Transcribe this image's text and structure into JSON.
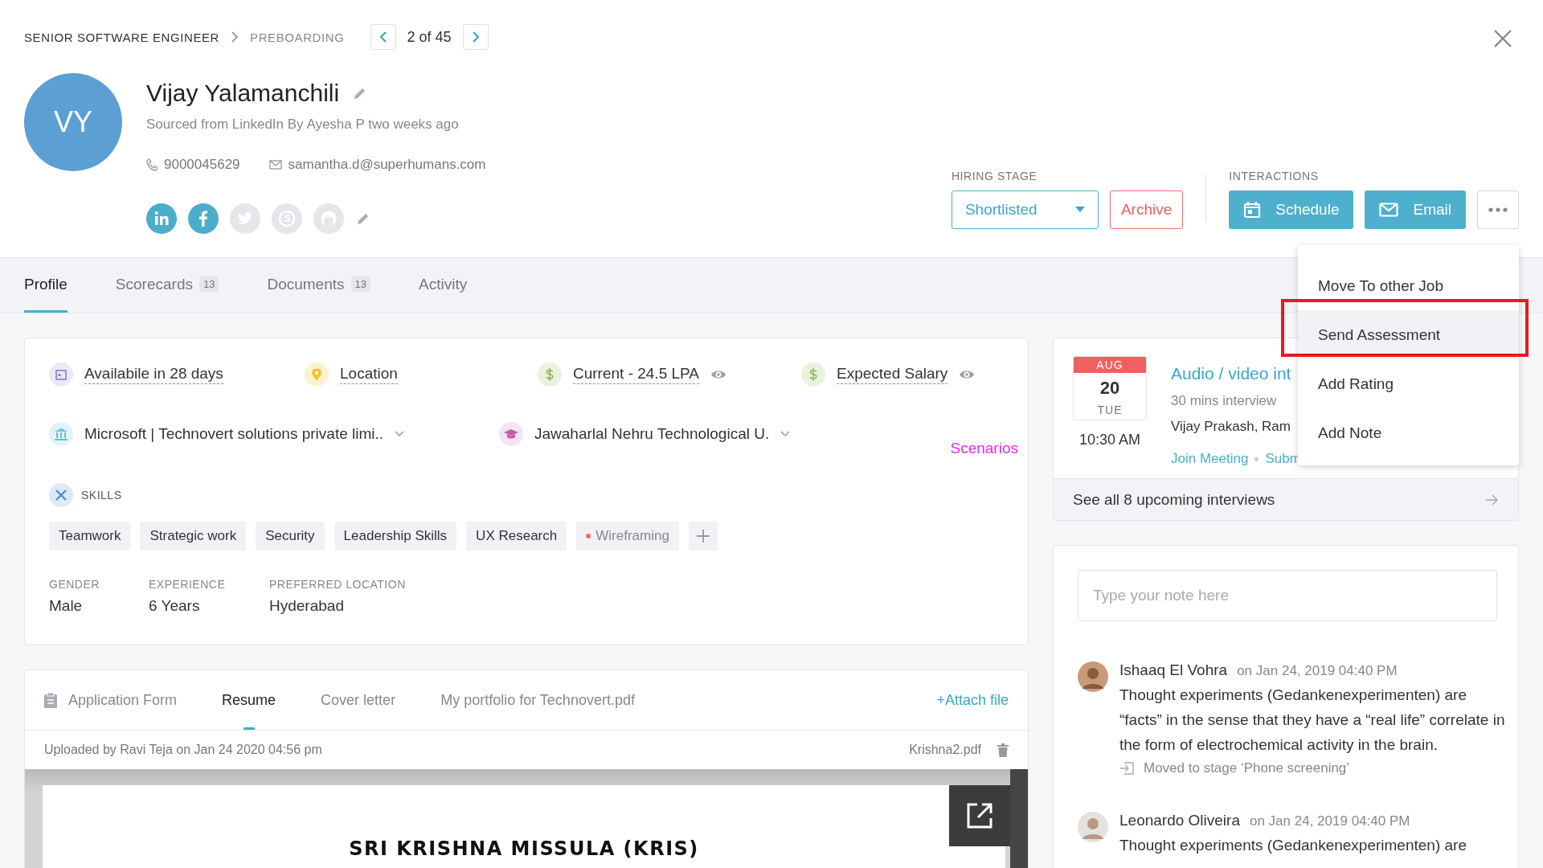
{
  "breadcrumb": [
    "SENIOR SOFTWARE ENGINEER",
    "PREBOARDING"
  ],
  "pager": "2 of 45",
  "candidate": {
    "initials": "VY",
    "name": "Vijay Yalamanchili",
    "source": "Sourced from LinkedIn By Ayesha P two weeks ago",
    "phone": "9000045629",
    "email": "samantha.d@superhumans.com"
  },
  "social": [
    {
      "kind": "linkedin",
      "linked": true
    },
    {
      "kind": "facebook",
      "linked": true
    },
    {
      "kind": "twitter",
      "linked": false
    },
    {
      "kind": "skype",
      "linked": false
    },
    {
      "kind": "github",
      "linked": false
    }
  ],
  "hiring_stage": {
    "label": "HIRING STAGE",
    "value": "Shortlisted"
  },
  "archive": "Archive",
  "interactions": {
    "label": "INTERACTIONS",
    "buttons": [
      {
        "kind": "schedule",
        "label": "Schedule"
      },
      {
        "kind": "email",
        "label": "Email"
      }
    ]
  },
  "menu": [
    {
      "label": "Move To other Job",
      "highlighted": false
    },
    {
      "label": "Send Assessment",
      "highlighted": true
    },
    {
      "label": "Add Rating",
      "highlighted": false
    },
    {
      "label": "Add Note",
      "highlighted": false
    }
  ],
  "tabs": [
    {
      "label": "Profile",
      "selected": true
    },
    {
      "label": "Scorecards",
      "count": "13",
      "selected": false
    },
    {
      "label": "Documents",
      "count": "13",
      "selected": false
    },
    {
      "label": "Activity",
      "selected": false
    }
  ],
  "facts": [
    {
      "kind": "calendar",
      "text": "Availabile in 28 days",
      "masked": false
    },
    {
      "kind": "pin",
      "text": "Location",
      "masked": false
    },
    {
      "kind": "money",
      "text": "Current - 24.5 LPA",
      "masked": true
    },
    {
      "kind": "money",
      "text": "Expected Salary",
      "masked": true
    }
  ],
  "education": [
    {
      "kind": "bank",
      "text": "Microsoft  |  Technovert solutions private limi.."
    },
    {
      "kind": "cap",
      "text": "Jawaharlal Nehru Technological U."
    }
  ],
  "scenarios": "Scenarios",
  "skills": {
    "title": "SKILLS",
    "tags": [
      {
        "label": "Teamwork",
        "flagged": false
      },
      {
        "label": "Strategic work",
        "flagged": false
      },
      {
        "label": "Security",
        "flagged": false
      },
      {
        "label": "Leadership Skills",
        "flagged": false
      },
      {
        "label": "UX Research",
        "flagged": false
      },
      {
        "label": "Wireframing",
        "flagged": true
      }
    ]
  },
  "details": [
    {
      "label": "GENDER",
      "value": "Male"
    },
    {
      "label": "EXPERIENCE",
      "value": "6 Years"
    },
    {
      "label": "PREFERRED LOCATION",
      "value": "Hyderabad"
    }
  ],
  "interview": {
    "month": "AUG",
    "day": "20",
    "weekday": "TUE",
    "time": "10:30 AM",
    "title": "Audio / video int",
    "duration": "30 mins interview",
    "people": "Vijay Prakash, Ram",
    "links": [
      "Join Meeting",
      "Subm"
    ],
    "footer": "See all 8 upcoming interviews"
  },
  "notes": {
    "placeholder": "Type your note here",
    "items": [
      {
        "author": "Ishaaq El Vohra",
        "date": "on Jan 24, 2019 04:40 PM",
        "text": "Thought experiments (Gedankenexperimenten) are “facts” in the sense that they have a “real life” correlate in the form of electrochemical activity in the brain.",
        "activity": "Moved to stage ‘Phone screening’"
      },
      {
        "author": "Leonardo Oliveira",
        "date": "on Jan 24, 2019 04:40 PM",
        "text": "Thought experiments (Gedankenexperimenten) are"
      }
    ]
  },
  "documents": {
    "tabs": [
      {
        "label": "Application Form",
        "selected": false
      },
      {
        "label": "Resume",
        "selected": true
      },
      {
        "label": "Cover letter",
        "selected": false
      },
      {
        "label": "My portfolio for Technovert.pdf",
        "selected": false
      }
    ],
    "attach": "+Attach file",
    "uploaded": "Uploaded by Ravi Teja on Jan 24 2020 04:56 pm",
    "file": "Krishna2.pdf",
    "preview_title": "SRI KRISHNA MISSULA (KRIS)"
  }
}
